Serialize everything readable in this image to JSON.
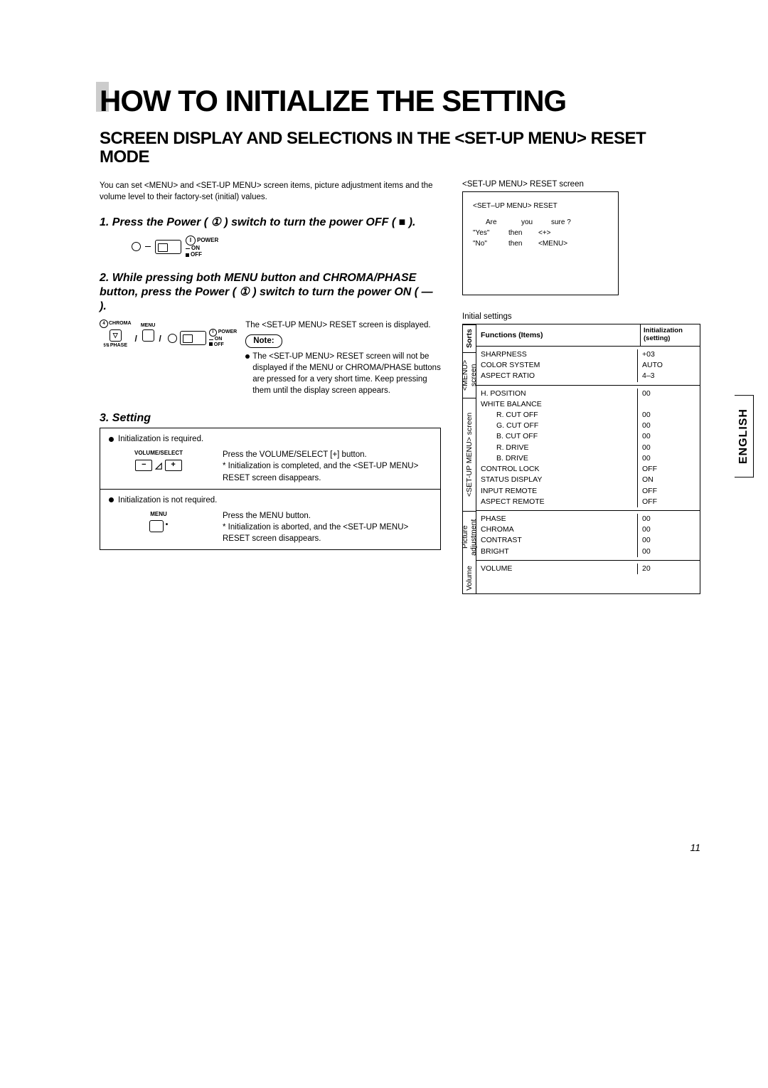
{
  "title": "HOW TO INITIALIZE THE SETTING",
  "subtitle": "SCREEN DISPLAY AND SELECTIONS IN THE <SET-UP MENU> RESET MODE",
  "intro": "You can set <MENU> and <SET-UP MENU> screen items, picture adjustment items and the volume level to their factory-set (initial) values.",
  "step1": {
    "text": "1. Press the Power ( ① ) switch to turn the power OFF ( ■ ).",
    "power_label": "POWER",
    "on": "ON",
    "off": "OFF"
  },
  "step2": {
    "text": "2. While pressing both MENU button and CHROMA/PHASE button, press the Power ( ① ) switch to turn the power ON ( — ).",
    "chroma": "CHROMA",
    "menu": "MENU",
    "phase": "PHASE",
    "power": "POWER",
    "on": "ON",
    "off": "OFF",
    "displayed": "The <SET-UP MENU> RESET screen is displayed.",
    "note_label": "Note:",
    "note_body": "The <SET-UP MENU> RESET screen will not be displayed if the MENU or CHROMA/PHASE buttons are pressed for a very short time. Keep pressing them until the display screen appears."
  },
  "step3": {
    "title": "3. Setting",
    "req_header": "Initialization is required.",
    "volselect": "VOLUME/SELECT",
    "req_l1": "Press the VOLUME/SELECT [+] button.",
    "req_l2": "* Initialization is completed, and the <SET-UP MENU> RESET screen disappears.",
    "notreq_header": "Initialization is not required.",
    "menu_label": "MENU",
    "notreq_l1": "Press the MENU button.",
    "notreq_l2": "* Initialization is aborted, and the <SET-UP MENU> RESET screen disappears."
  },
  "reset_caption": "<SET-UP MENU>  RESET screen",
  "reset_screen": {
    "header": "<SET–UP MENU> RESET",
    "r1": {
      "c1": "Are",
      "c2": "you",
      "c3": "sure ?"
    },
    "r2": {
      "c1": "\"Yes\"",
      "c2": "then",
      "c3": "<+>"
    },
    "r3": {
      "c1": "\"No\"",
      "c2": "then",
      "c3": "<MENU>"
    }
  },
  "init_caption": "Initial settings",
  "table": {
    "sorts_head": "Sorts",
    "sort_menu": "<MENU> screen",
    "sort_setup": "<SET-UP MENU> screen",
    "sort_pic": "Picture adjustment",
    "sort_vol": "Volume",
    "func_head": "Functions (Items)",
    "init_head1": "Initialization",
    "init_head2": "(setting)",
    "sections": [
      {
        "rows": [
          {
            "f": "SHARPNESS",
            "v": "+03"
          },
          {
            "f": "COLOR SYSTEM",
            "v": "AUTO"
          },
          {
            "f": "ASPECT RATIO",
            "v": "4–3"
          }
        ]
      },
      {
        "rows": [
          {
            "f": "H. POSITION",
            "v": "00"
          },
          {
            "f": "WHITE BALANCE",
            "v": ""
          },
          {
            "f": "R. CUT OFF",
            "v": "00",
            "indent": true
          },
          {
            "f": "G. CUT OFF",
            "v": "00",
            "indent": true
          },
          {
            "f": "B. CUT OFF",
            "v": "00",
            "indent": true
          },
          {
            "f": "R. DRIVE",
            "v": "00",
            "indent": true
          },
          {
            "f": "B. DRIVE",
            "v": "00",
            "indent": true
          },
          {
            "f": "CONTROL LOCK",
            "v": "OFF"
          },
          {
            "f": "STATUS DISPLAY",
            "v": "ON"
          },
          {
            "f": "INPUT REMOTE",
            "v": "OFF"
          },
          {
            "f": "ASPECT REMOTE",
            "v": "OFF"
          }
        ]
      },
      {
        "rows": [
          {
            "f": "PHASE",
            "v": "00"
          },
          {
            "f": "CHROMA",
            "v": "00"
          },
          {
            "f": "CONTRAST",
            "v": "00"
          },
          {
            "f": "BRIGHT",
            "v": "00"
          }
        ]
      },
      {
        "rows": [
          {
            "f": "VOLUME",
            "v": "20"
          }
        ]
      }
    ]
  },
  "lang": "ENGLISH",
  "page_num": "11"
}
